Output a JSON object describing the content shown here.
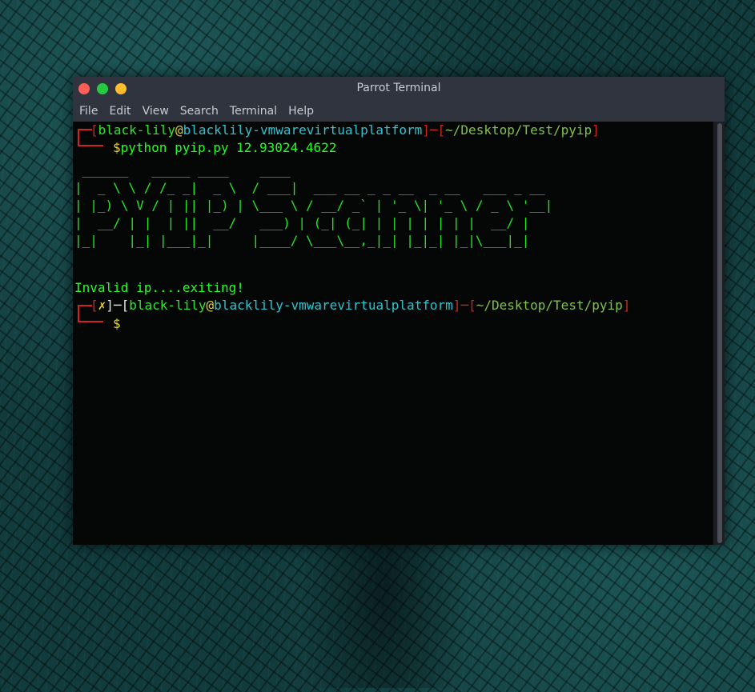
{
  "window": {
    "title": "Parrot Terminal",
    "buttons": {
      "close": "#ff5f57",
      "maximize": "#28c840",
      "minimize": "#ffbd2e"
    }
  },
  "menu": [
    "File",
    "Edit",
    "View",
    "Search",
    "Terminal",
    "Help"
  ],
  "prompt1": {
    "open": "[",
    "user": "black-lily",
    "at": "@",
    "host": "blacklily-vmwarevirtualplatform",
    "close": "]",
    "dash": "─",
    "path_open": "[",
    "path": "~/Desktop/Test/pyip",
    "path_close": "]",
    "dollar": "$",
    "command": "python pyip.py 12.93024.4622"
  },
  "ascii_art": [
    " ______   _____ ____    ____",
    "|  _ \\ \\ / /_ _|  _ \\  / ___|  ___ __ _ _ __  _ __   ___ _ __",
    "| |_) \\ V / | || |_) | \\___ \\ / __/ _` | '_ \\| '_ \\ / _ \\ '__|",
    "|  __/ | |  | ||  __/   ___) | (_| (_| | | | | | | |  __/ |",
    "|_|    |_| |___|_|     |____/ \\___\\__,_|_| |_|_| |_|\\___|_|"
  ],
  "output": "Invalid ip....exiting!",
  "prompt2": {
    "open_x": "[",
    "x": "✗",
    "close_x": "]",
    "dash": "─",
    "open": "[",
    "user": "black-lily",
    "at": "@",
    "host": "blacklily-vmwarevirtualplatform",
    "close": "]",
    "dash2": "─",
    "path_open": "[",
    "path": "~/Desktop/Test/pyip",
    "path_close": "]",
    "dollar": "$"
  },
  "colors": {
    "prompt_red": "#d02424",
    "user_green": "#2ee62e",
    "host_cyan": "#31c2d0",
    "at_yellow": "#e5d23a",
    "path_green": "#7fc24d",
    "ascii_green": "#22e822"
  }
}
